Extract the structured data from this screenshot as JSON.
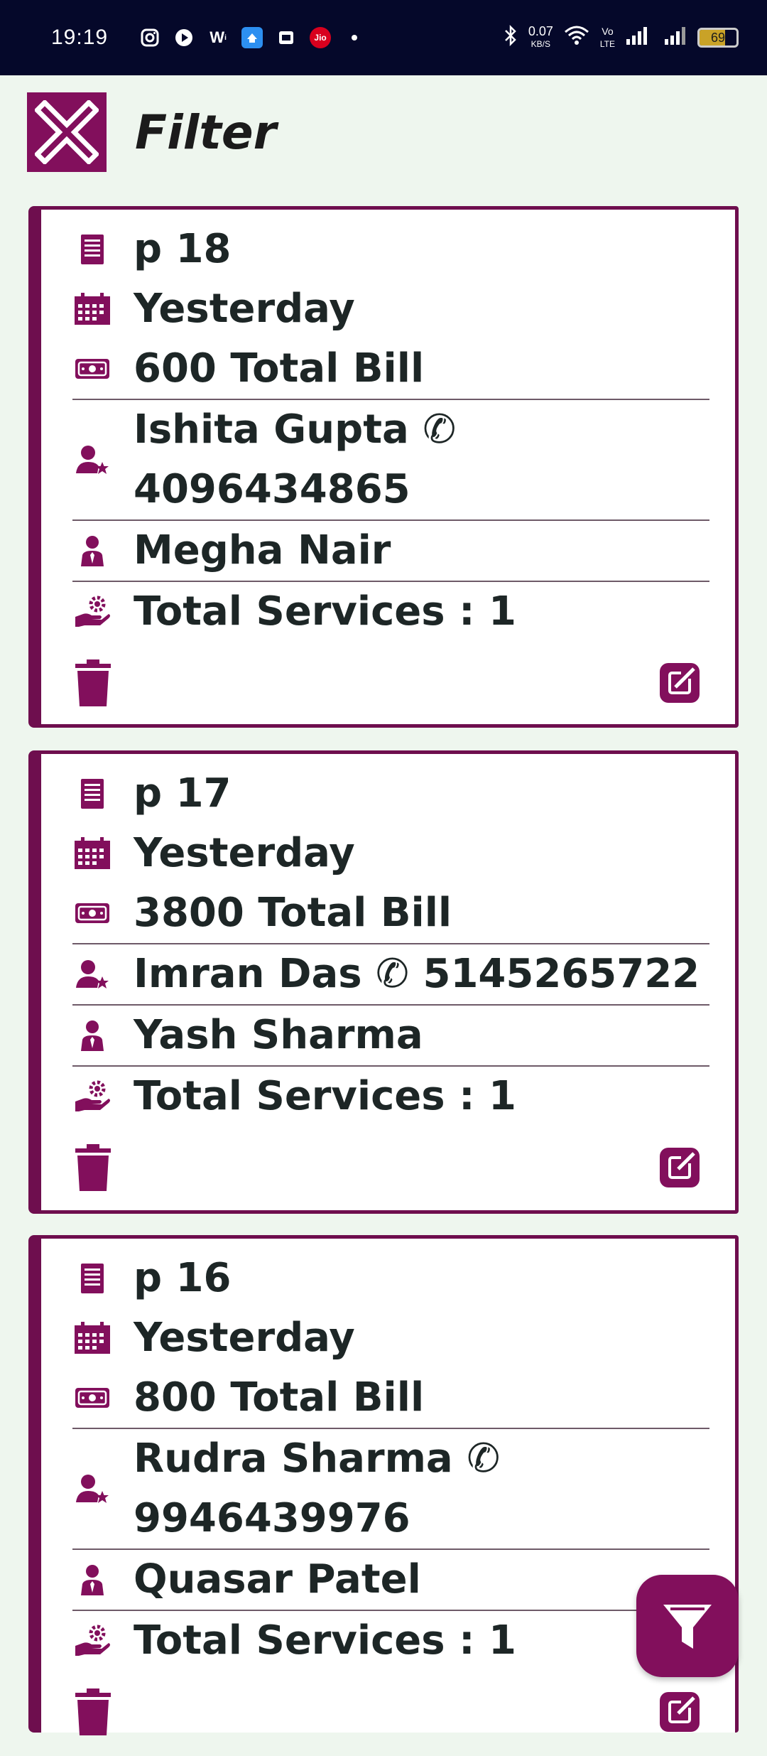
{
  "status_bar": {
    "time": "19:19",
    "speed_value": "0.07",
    "speed_unit": "KB/S",
    "network_label_top": "Vo",
    "network_label_bottom": "LTE",
    "battery_percent": "69",
    "icons": [
      "instagram-icon",
      "youtube-icon",
      "wynk-icon",
      "app-icon",
      "gallery-icon",
      "jio-icon",
      "dot-icon",
      "bluetooth-icon",
      "wifi-icon",
      "signal-icon",
      "battery-icon"
    ]
  },
  "header": {
    "title": "Filter"
  },
  "accent_color": "#820f5c",
  "cards": [
    {
      "bill_no": "p 18",
      "date": "Yesterday",
      "total_bill": "600 Total Bill",
      "customer_line1": "Ishita Gupta ✆",
      "customer_line2": "4096434865",
      "staff": "Megha Nair",
      "services": "Total Services : 1"
    },
    {
      "bill_no": "p 17",
      "date": "Yesterday",
      "total_bill": "3800 Total Bill",
      "customer_line1": "Imran Das ✆ 5145265722",
      "staff": "Yash Sharma",
      "services": "Total Services : 1"
    },
    {
      "bill_no": "p 16",
      "date": "Yesterday",
      "total_bill": "800 Total Bill",
      "customer_line1": "Rudra Sharma ✆",
      "customer_line2": "9946439976",
      "staff": "Quasar Patel",
      "services": "Total Services : 1"
    }
  ]
}
